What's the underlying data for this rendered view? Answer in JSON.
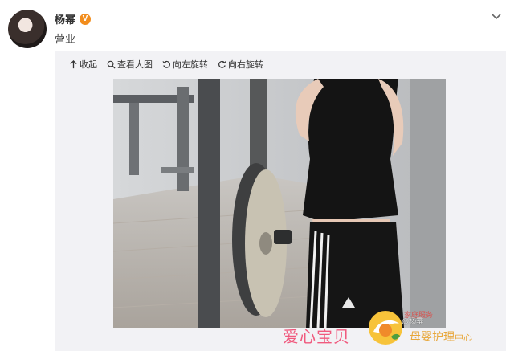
{
  "post": {
    "username": "杨幂",
    "badge": "V",
    "text": "营业"
  },
  "toolbar": {
    "collapse": "收起",
    "view_large": "查看大图",
    "rotate_left": "向左旋转",
    "rotate_right": "向右旋转"
  },
  "watermark": {
    "brand_cn": "爱心宝贝",
    "brand_sub": "母婴护理",
    "brand_sub_small": "中心",
    "service": "家庭服务",
    "weibo": "@杨幂"
  },
  "colors": {
    "badge": "#f28d1d",
    "brand_pink": "#f05a7e",
    "brand_gold": "#e8a73a"
  }
}
